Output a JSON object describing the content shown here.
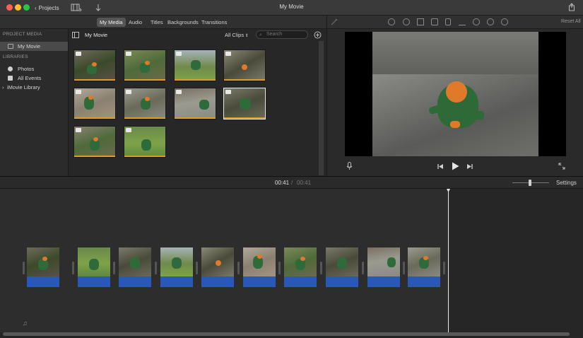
{
  "window": {
    "title": "My Movie",
    "projects_label": "Projects"
  },
  "tabs": [
    {
      "label": "My Media",
      "active": true
    },
    {
      "label": "Audio"
    },
    {
      "label": "Titles"
    },
    {
      "label": "Backgrounds"
    },
    {
      "label": "Transitions"
    }
  ],
  "sidebar": {
    "project_media_header": "PROJECT MEDIA",
    "project_item": "My Movie",
    "libraries_header": "LIBRARIES",
    "library_items": [
      "Photos",
      "All Events",
      "iMovie Library"
    ]
  },
  "browser": {
    "title": "My Movie",
    "filter": "All Clips",
    "search_placeholder": "Search"
  },
  "viewer": {
    "reset_all": "Reset All"
  },
  "timeline": {
    "current_time": "00:41",
    "separator": "/",
    "total_time": "00:41",
    "settings_label": "Settings"
  },
  "colors": {
    "accent_orange": "#e79b1e",
    "audio_blue": "#2a58b8"
  },
  "icons": [
    "film-strip-icon",
    "download-icon",
    "share-icon",
    "sidebar-toggle-icon",
    "search-icon",
    "add-icon",
    "magic-wand-icon",
    "color-balance-icon",
    "color-correction-icon",
    "crop-icon",
    "stabilization-icon",
    "volume-icon",
    "equalizer-icon",
    "speed-icon",
    "noise-reduction-icon",
    "filter-icon",
    "info-icon",
    "microphone-icon",
    "skip-back-icon",
    "play-icon",
    "skip-forward-icon",
    "fullscreen-icon",
    "music-note-icon"
  ]
}
